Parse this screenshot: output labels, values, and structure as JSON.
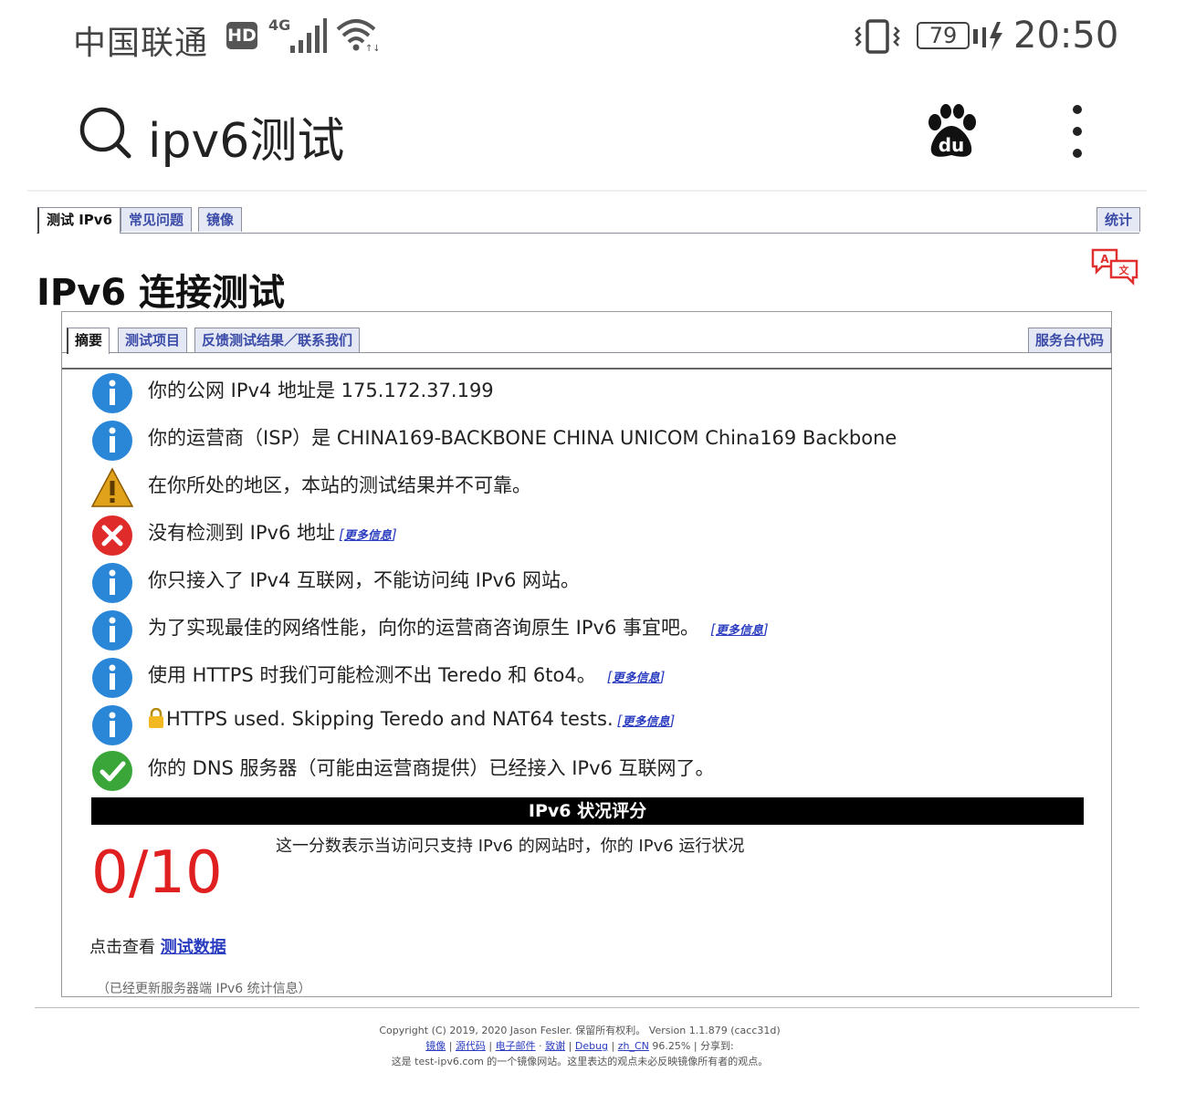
{
  "status_bar": {
    "carrier": "中国联通",
    "hd": "HD",
    "network": "4G",
    "battery": "79",
    "time": "20:50"
  },
  "search": {
    "query": "ipv6测试"
  },
  "site_tabs": {
    "items": [
      "测试 IPv6",
      "常见问题",
      "镜像"
    ],
    "right": "统计"
  },
  "page_title": "IPv6 连接测试",
  "panel_tabs": {
    "items": [
      "摘要",
      "测试项目",
      "反馈测试结果／联系我们"
    ],
    "right": "服务台代码"
  },
  "results": [
    {
      "icon": "info",
      "text": "你的公网 IPv4 地址是 175.172.37.199",
      "link": ""
    },
    {
      "icon": "info",
      "text": "你的运营商（ISP）是 CHINA169-BACKBONE CHINA UNICOM China169 Backbone",
      "link": ""
    },
    {
      "icon": "warning",
      "text": "在你所处的地区，本站的测试结果并不可靠。",
      "link": ""
    },
    {
      "icon": "error",
      "text": "没有检测到 IPv6 地址",
      "link": "更多信息"
    },
    {
      "icon": "info",
      "text": "你只接入了 IPv4 互联网，不能访问纯 IPv6 网站。",
      "link": ""
    },
    {
      "icon": "info",
      "text": "为了实现最佳的网络性能，向你的运营商咨询原生 IPv6 事宜吧。",
      "link": "更多信息"
    },
    {
      "icon": "info",
      "text": "使用 HTTPS 时我们可能检测不出 Teredo 和 6to4。",
      "link": "更多信息"
    },
    {
      "icon": "info",
      "text": "HTTPS used. Skipping Teredo and NAT64 tests.",
      "link": "更多信息"
    },
    {
      "icon": "ok",
      "text": "你的 DNS 服务器（可能由运营商提供）已经接入 IPv6 互联网了。",
      "link": ""
    }
  ],
  "score": {
    "header": "IPv6 状况评分",
    "description": "这一分数表示当访问只支持 IPv6 的网站时，你的 IPv6 运行状况",
    "value": "0/10",
    "view_prefix": "点击查看",
    "view_link": "测试数据",
    "updated_note": "（已经更新服务器端 IPv6 统计信息）"
  },
  "footer": {
    "line1": "Copyright (C) 2019, 2020 Jason Fesler. 保留所有权利。 Version 1.1.879 (cacc31d)",
    "links": [
      "镜像",
      "源代码",
      "电子邮件",
      "致谢",
      "Debug"
    ],
    "locale": "zh_CN",
    "percent": "96.25%",
    "share": "分享到:",
    "line3": "这是 test-ipv6.com 的一个镜像网站。这里表达的观点未必反映镜像所有者的观点。"
  },
  "colors": {
    "info_blue": "#2a86d6",
    "error_red": "#e02b2b",
    "ok_green": "#3aa63a",
    "warning_amber": "#e0a21a",
    "link_blue": "#2a3cc0",
    "score_red": "#e02020"
  }
}
